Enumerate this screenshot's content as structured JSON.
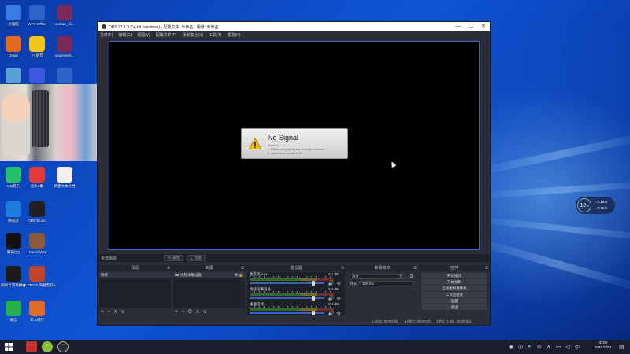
{
  "desktop": {
    "icons": [
      {
        "label": "此电脑",
        "icon": "computer-icon",
        "color": "#3a7be0"
      },
      {
        "label": "WPS Office",
        "icon": "wps-icon",
        "color": "#2e62c8"
      },
      {
        "label": "xkshan_sli...",
        "icon": "archive-icon",
        "color": "#7a2a5a"
      },
      {
        "label": "Origin",
        "icon": "origin-icon",
        "color": "#e46a1a"
      },
      {
        "label": "YY语音",
        "icon": "yy-icon",
        "color": "#f5c518"
      },
      {
        "label": "Voicemeet...",
        "icon": "archive-icon",
        "color": "#7a2a5a"
      },
      {
        "label": "",
        "icon": "recycle-bin-icon",
        "color": "#5aa0d8"
      },
      {
        "label": "",
        "icon": "video-player-icon",
        "color": "#3c59e0"
      },
      {
        "label": "",
        "icon": "floppy-icon",
        "color": "#2e62c8"
      },
      {
        "label": "QQ音乐",
        "icon": "qq-music-icon",
        "color": "#24c06a"
      },
      {
        "label": "全民K歌",
        "icon": "kge-icon",
        "color": "#e23a3a"
      },
      {
        "label": "新建文本文档",
        "icon": "text-file-icon",
        "color": "#f0f0f0"
      },
      {
        "label": "腾讯游",
        "icon": "tencent-game-icon",
        "color": "#1e7ce0"
      },
      {
        "label": "OBS Studio",
        "icon": "obs-icon",
        "color": "#202020"
      },
      {
        "label": "腾讯QQ",
        "icon": "qq-icon",
        "color": "#111111"
      },
      {
        "label": "Hole In Wite",
        "icon": "game-icon",
        "color": "#8a5a3a"
      },
      {
        "label": "网易云游戏平台",
        "icon": "netease-icon",
        "color": "#1a1a1a"
      },
      {
        "label": "ONE PIECE 海贼无双4",
        "icon": "onepiece-icon",
        "color": "#c0442a"
      },
      {
        "label": "微信",
        "icon": "wechat-icon",
        "color": "#2ab04a"
      },
      {
        "label": "双人成行",
        "icon": "it-takes-two-icon",
        "color": "#e06a2a"
      }
    ]
  },
  "obs": {
    "title": "OBS 27.1.3 (64-bit, windows) - 配置文件: 未命名 - 场景: 未命名",
    "window_controls": {
      "minimize": "—",
      "maximize": "☐",
      "close": "✕"
    },
    "menu": [
      "文件(F)",
      "编辑(E)",
      "视图(V)",
      "配置文件(P)",
      "场景集合(S)",
      "工具(T)",
      "帮助(H)"
    ],
    "preview": {
      "no_signal": {
        "title": "No Signal",
        "lines": [
          "Check if:",
          "1. Cables are properly and securely connected",
          "2. Input source device is ON"
        ]
      }
    },
    "source_bar": {
      "label": "未选择源",
      "properties": "属性",
      "filters": "滤镜"
    },
    "docks": {
      "scenes": {
        "title": "场景",
        "items": [
          "场景"
        ]
      },
      "sources": {
        "title": "来源",
        "items": [
          "视频采集设备"
        ]
      },
      "mixer": {
        "title": "混音器",
        "tracks": [
          {
            "name": "麦克风/Aux",
            "db": "0.0 dB",
            "level": 0.85
          },
          {
            "name": "视频采集设备",
            "db": "0.0 dB",
            "level": 0.85
          },
          {
            "name": "桌面音频",
            "db": "0.0 dB",
            "level": 0.85
          }
        ]
      },
      "transitions": {
        "title": "转场特效",
        "type": "渐变",
        "duration_label": "时长",
        "duration_value": "300 ms"
      },
      "controls": {
        "title": "控件",
        "buttons": [
          "开始推流",
          "开始录制",
          "启动虚拟摄像机",
          "工作室模式",
          "设置",
          "退出"
        ]
      }
    },
    "tool_symbols": {
      "add": "+",
      "remove": "−",
      "up": "∧",
      "down": "∨",
      "gear": "⚙"
    },
    "status": {
      "live": "LIVE: 00:00:00",
      "rec": "REC: 00:00:00",
      "cpu": "CPU: 0.4%, 30.00 fps"
    }
  },
  "net_monitor": {
    "value": "12",
    "unit": "%",
    "up": "0.1K/s",
    "down": "0.7K/s"
  },
  "taskbar": {
    "time": "20:00",
    "date": "2022/1/23",
    "ime": "中"
  },
  "colors": {
    "obs_bg": "#2b2e38",
    "accent": "#3a5fbf",
    "taskbar": "#1a1d2c"
  }
}
